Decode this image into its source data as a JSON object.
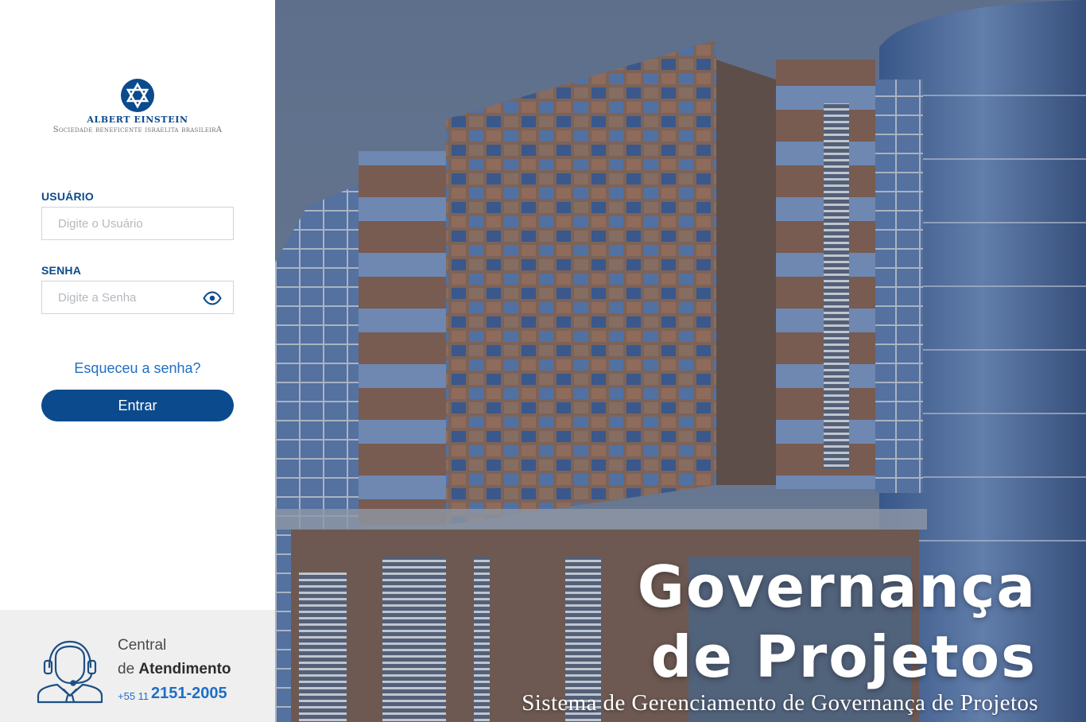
{
  "logo": {
    "name": "ALBERT EINSTEIN",
    "subtitle": "Sociedade beneficente israelita brasileirA"
  },
  "login": {
    "user_label": "USUÁRIO",
    "user_placeholder": "Digite o Usuário",
    "user_value": "",
    "password_label": "SENHA",
    "password_placeholder": "Digite a Senha",
    "password_value": "",
    "forgot_link": "Esqueceu a senha?",
    "submit_label": "Entrar"
  },
  "support": {
    "line1": "Central",
    "line2_prefix": "de",
    "line2_bold": "Atendimento",
    "phone_prefix": "+55 11",
    "phone_number": "2151-2005"
  },
  "hero": {
    "title_line1": "Governança",
    "title_line2": "de Projetos",
    "subtitle": "Sistema de Gerenciamento de Governança de Projetos"
  },
  "colors": {
    "brand_blue": "#0b4a8c",
    "link_blue": "#1f6ec7",
    "footer_gray": "#efefef"
  },
  "icons": {
    "logo": "star-of-david-logo-icon",
    "password_toggle": "eye-icon",
    "support": "headset-agent-icon"
  }
}
